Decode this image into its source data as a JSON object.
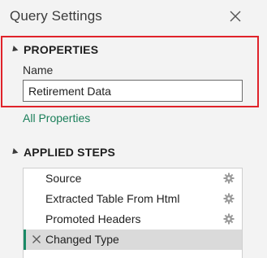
{
  "pane": {
    "title": "Query Settings"
  },
  "properties": {
    "header": "PROPERTIES",
    "name_label": "Name",
    "name_value": "Retirement Data",
    "all_properties_link": "All Properties"
  },
  "applied_steps": {
    "header": "APPLIED STEPS",
    "steps": [
      {
        "label": "Source",
        "has_settings": true,
        "selected": false
      },
      {
        "label": "Extracted Table From Html",
        "has_settings": true,
        "selected": false
      },
      {
        "label": "Promoted Headers",
        "has_settings": true,
        "selected": false
      },
      {
        "label": "Changed Type",
        "has_settings": false,
        "selected": true
      }
    ]
  },
  "colors": {
    "highlight_box": "#e0232a",
    "link": "#1a7f5a",
    "selected_accent": "#1a8a66",
    "selected_bg": "#dadada"
  },
  "icons": {
    "close": "close-icon",
    "collapse": "triangle-down-icon",
    "settings": "gear-icon",
    "delete": "delete-x-icon"
  }
}
